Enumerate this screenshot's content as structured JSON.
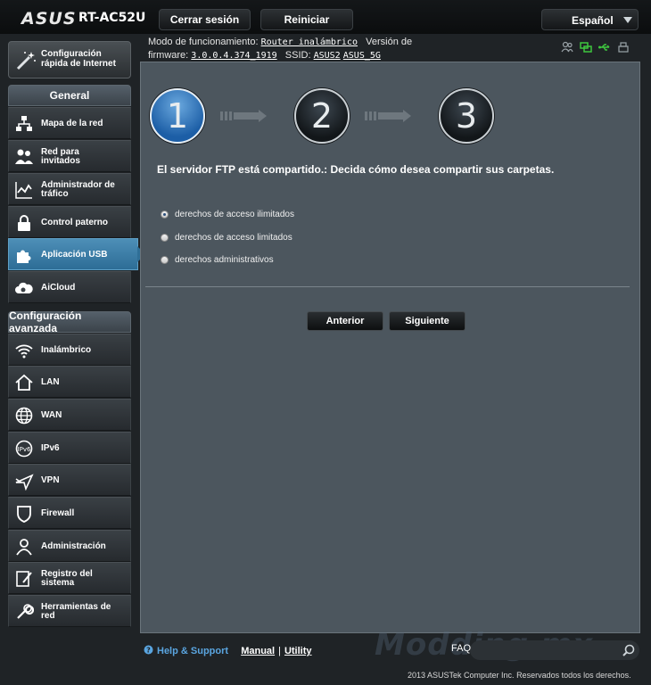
{
  "header": {
    "brand": "ASUS",
    "model": "RT-AC52U",
    "logout_label": "Cerrar sesión",
    "reboot_label": "Reiniciar",
    "language": "Español"
  },
  "info": {
    "mode_label": "Modo de funcionamiento:",
    "mode_value": "Router inalámbrico",
    "version_label": "Versión de",
    "firmware_label": "firmware:",
    "firmware_value": "3.0.0.4.374_1919",
    "ssid_label": "SSID:",
    "ssid_1": "ASUS2",
    "ssid_2": "ASUS_5G"
  },
  "sidebar": {
    "quick_setup_line1": "Configuración",
    "quick_setup_line2": "rápida de Internet",
    "general_title": "General",
    "general_items": [
      {
        "l1": "Mapa de la red",
        "l2": ""
      },
      {
        "l1": "Red para",
        "l2": "invitados"
      },
      {
        "l1": "Administrador de",
        "l2": "tráfico"
      },
      {
        "l1": "Control paterno",
        "l2": ""
      },
      {
        "l1": "Aplicación USB",
        "l2": ""
      },
      {
        "l1": "AiCloud",
        "l2": ""
      }
    ],
    "advanced_title": "Configuración avanzada",
    "advanced_items": [
      {
        "l1": "Inalámbrico",
        "l2": ""
      },
      {
        "l1": "LAN",
        "l2": ""
      },
      {
        "l1": "WAN",
        "l2": ""
      },
      {
        "l1": "IPv6",
        "l2": ""
      },
      {
        "l1": "VPN",
        "l2": ""
      },
      {
        "l1": "Firewall",
        "l2": ""
      },
      {
        "l1": "Administración",
        "l2": ""
      },
      {
        "l1": "Registro del",
        "l2": "sistema"
      },
      {
        "l1": "Herramientas de",
        "l2": "red"
      }
    ]
  },
  "wizard": {
    "steps": [
      "1",
      "2",
      "3"
    ],
    "current_step": 1,
    "title": "El servidor FTP está compartido.: Decida cómo desea compartir sus carpetas.",
    "options": [
      "derechos de acceso ilimitados",
      "derechos de acceso limitados",
      "derechos administrativos"
    ],
    "selected_option": 0,
    "prev_label": "Anterior",
    "next_label": "Siguiente"
  },
  "footer": {
    "help": "Help & Support",
    "manual": "Manual",
    "separator": "|",
    "utility": "Utility",
    "faq": "FAQ",
    "watermark": "Modding mx",
    "copyright": "2013 ASUSTek Computer Inc. Reservados todos los derechos."
  },
  "colors": {
    "accent_blue": "#2d6d96",
    "panel_bg": "#4c565e",
    "page_bg": "#1f2326",
    "help_link": "#5aa5e0",
    "status_green": "#3ec63e"
  }
}
